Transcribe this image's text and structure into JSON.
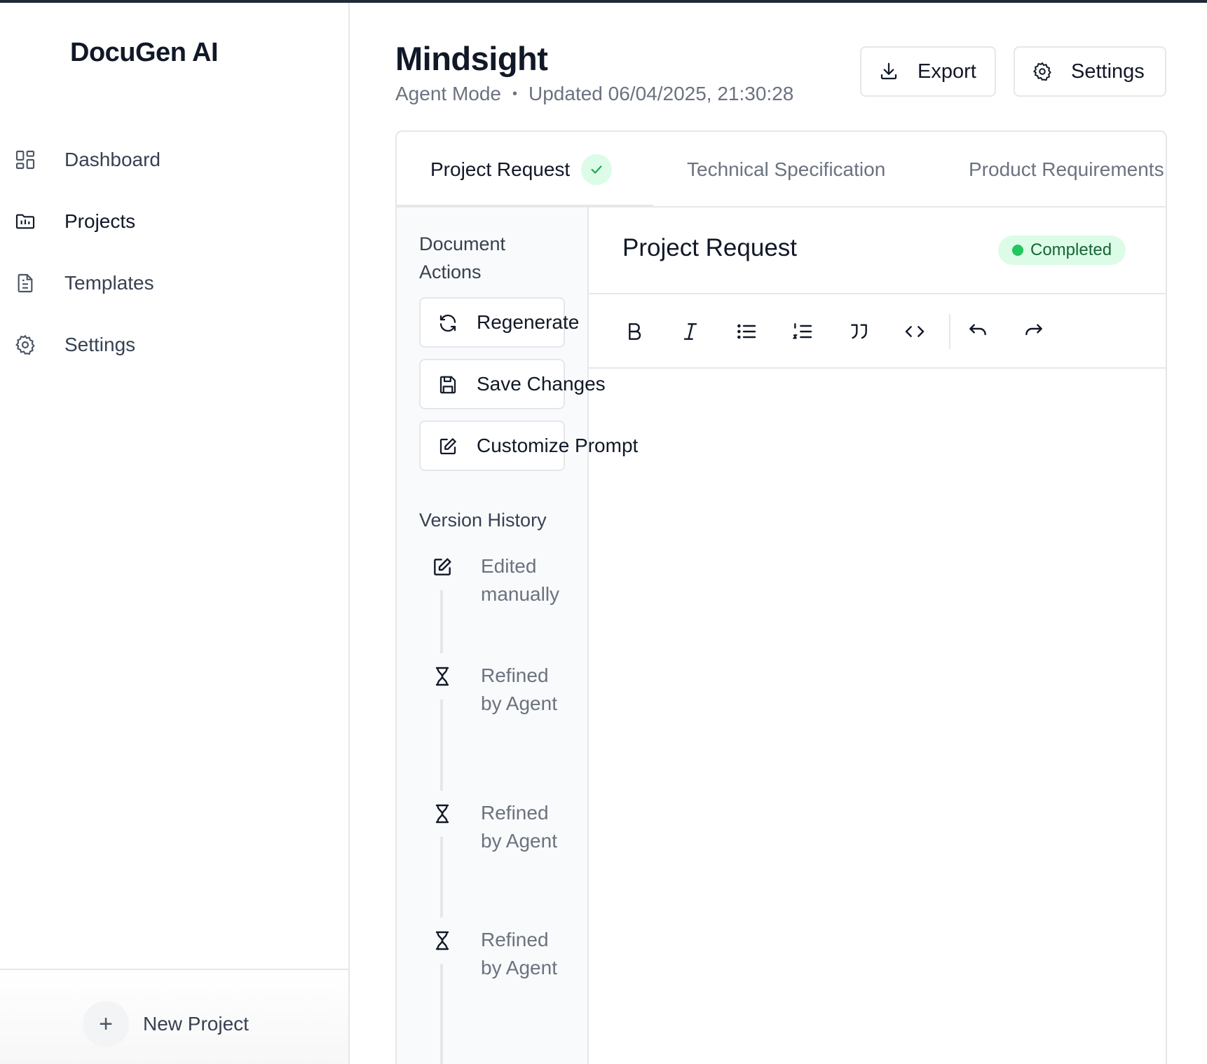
{
  "sidebar": {
    "brand": "DocuGen AI",
    "items": [
      {
        "label": "Dashboard",
        "icon": "dashboard-icon",
        "active": false
      },
      {
        "label": "Projects",
        "icon": "folder-icon",
        "active": true
      },
      {
        "label": "Templates",
        "icon": "document-icon",
        "active": false
      },
      {
        "label": "Settings",
        "icon": "gear-icon",
        "active": false
      }
    ],
    "new_project_label": "New Project"
  },
  "header": {
    "title": "Mindsight",
    "mode": "Agent Mode",
    "updated": "Updated 06/04/2025, 21:30:28",
    "export_label": "Export",
    "settings_label": "Settings"
  },
  "tabs": [
    {
      "label": "Project Request",
      "active": true,
      "completed": true
    },
    {
      "label": "Technical Specification",
      "active": false
    },
    {
      "label": "Product Requirements",
      "active": false
    }
  ],
  "actions": {
    "heading": "Document Actions",
    "regenerate_label": "Regenerate",
    "save_label": "Save Changes",
    "customize_label": "Customize Prompt"
  },
  "version_history": {
    "heading": "Version History",
    "entries": [
      {
        "label": "Edited manually",
        "icon": "edit-icon"
      },
      {
        "label": "Refined by Agent",
        "icon": "hourglass-icon"
      },
      {
        "label": "Refined by Agent",
        "icon": "hourglass-icon"
      },
      {
        "label": "Refined by Agent",
        "icon": "hourglass-icon"
      }
    ]
  },
  "editor": {
    "title": "Project Request",
    "status": "Completed",
    "status_color": "#22c55e",
    "toolbar": [
      "bold-icon",
      "italic-icon",
      "bullet-list-icon",
      "numbered-list-icon",
      "quote-icon",
      "code-icon",
      "undo-icon",
      "redo-icon"
    ]
  }
}
